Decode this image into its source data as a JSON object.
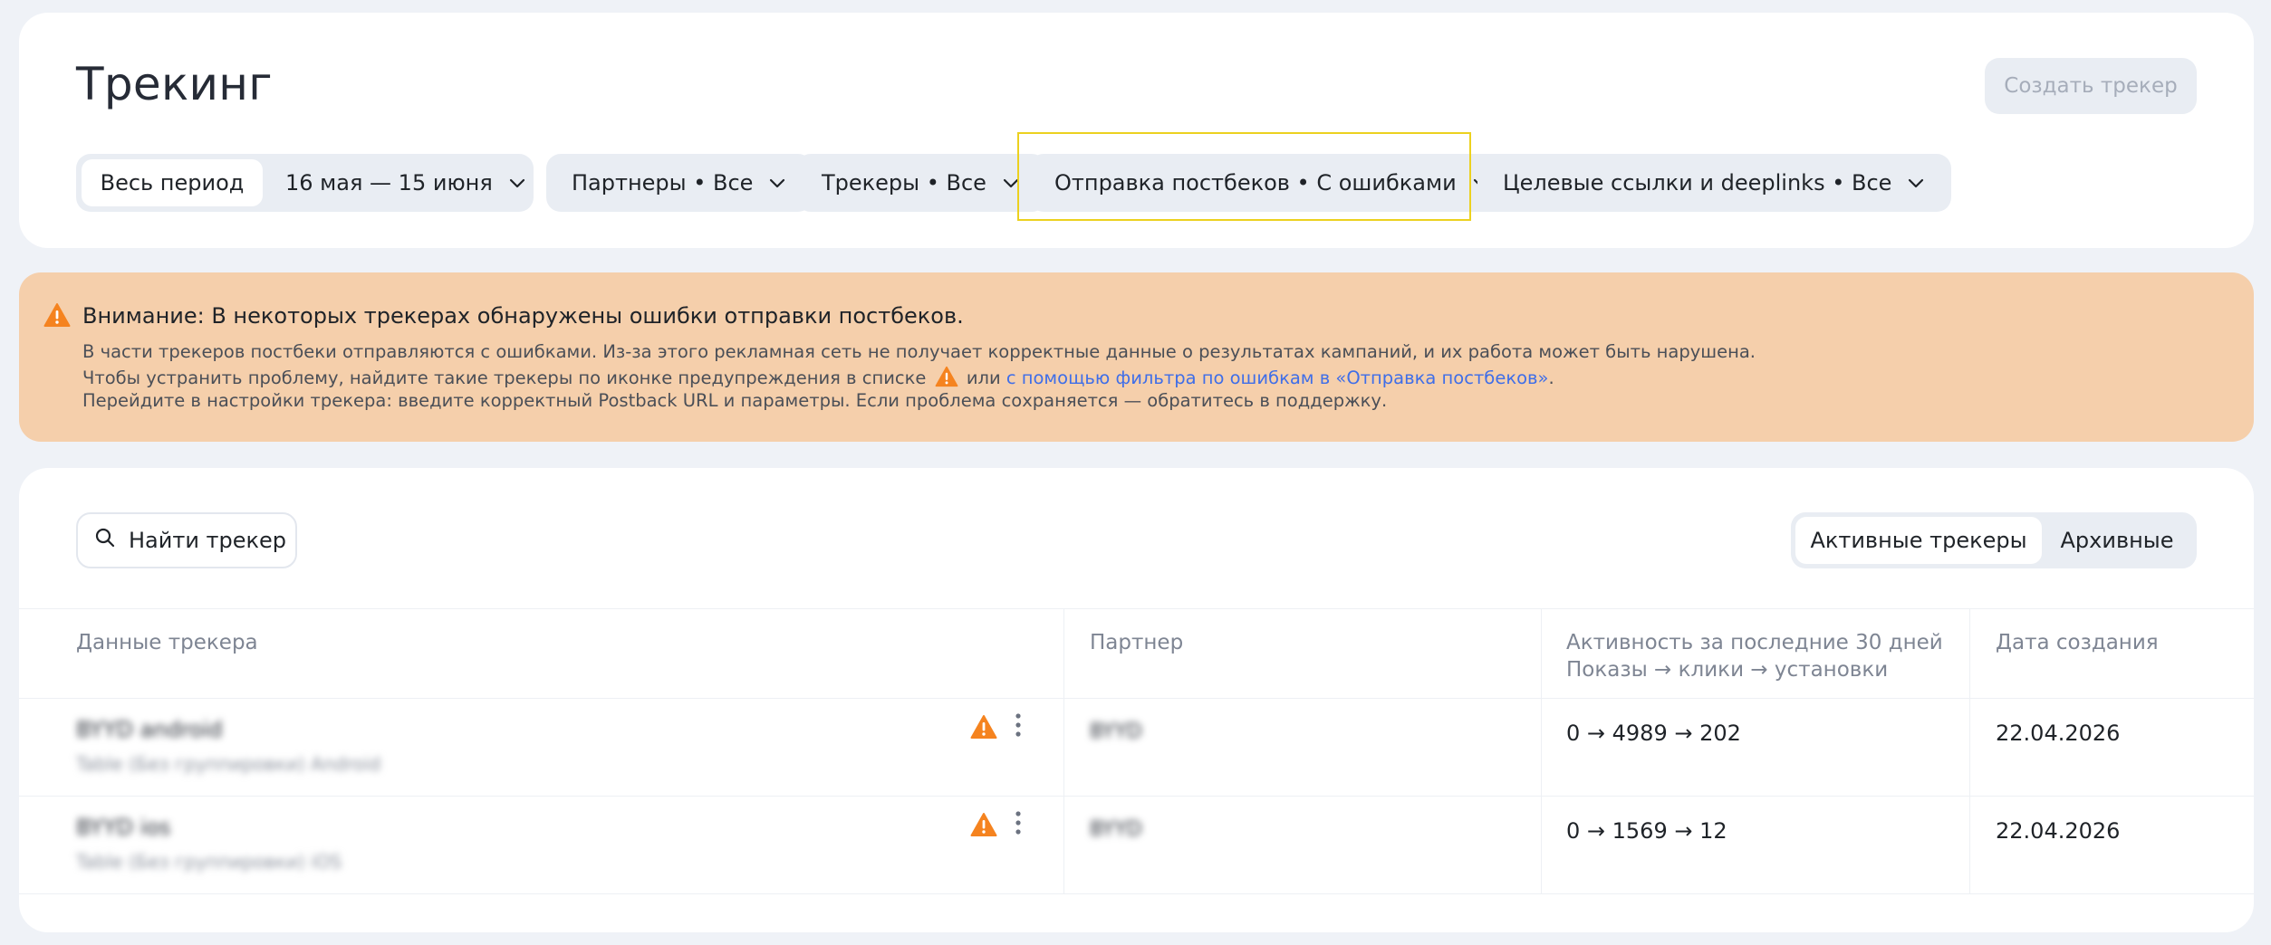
{
  "header": {
    "title": "Трекинг",
    "create_button": "Создать трекер"
  },
  "filters": {
    "period_label": "Весь период",
    "date_range": "16 мая — 15 июня",
    "partners": "Партнеры • Все",
    "trackers": "Трекеры • Все",
    "postbacks": "Отправка постбеков • С ошибками",
    "links": "Целевые ссылки и deeplinks • Все"
  },
  "alert": {
    "title": "Внимание: В некоторых трекерах обнаружены ошибки отправки постбеков.",
    "line1": "В части трекеров постбеки отправляются с ошибками. Из-за этого рекламная сеть не получает корректные данные о результатах кампаний, и их работа может быть нарушена.",
    "line2_prefix": "Чтобы устранить проблему, найдите такие трекеры по иконке предупреждения в списке",
    "line2_mid": "или",
    "line2_link": "с помощью фильтра по ошибкам в «Отправка постбеков»",
    "line2_suffix": ".",
    "line3": "Перейдите в настройки трекера: введите корректный Postback URL и параметры. Если проблема сохраняется — обратитесь в поддержку."
  },
  "toolbar": {
    "search_label": "Найти трекер",
    "tab_active": "Активные трекеры",
    "tab_archive": "Архивные"
  },
  "table": {
    "columns": {
      "tracker": "Данные трекера",
      "partner": "Партнер",
      "activity_line1": "Активность за последние 30 дней",
      "activity_line2": "Показы → клики → установки",
      "created": "Дата создания"
    },
    "rows": [
      {
        "name": "BYYD android",
        "subtitle": "Table (Без группировки) Android",
        "partner": "BYYD",
        "activity": "0 → 4989 → 202",
        "created": "22.04.2026"
      },
      {
        "name": "BYYD ios",
        "subtitle": "Table (Без группировки) iOS",
        "partner": "BYYD",
        "activity": "0 → 1569 → 12",
        "created": "22.04.2026"
      }
    ]
  },
  "colors": {
    "warning": "#f5831f",
    "alert_bg": "#f5cfab",
    "link": "#3f6ee8",
    "highlight": "#ecd11f"
  }
}
